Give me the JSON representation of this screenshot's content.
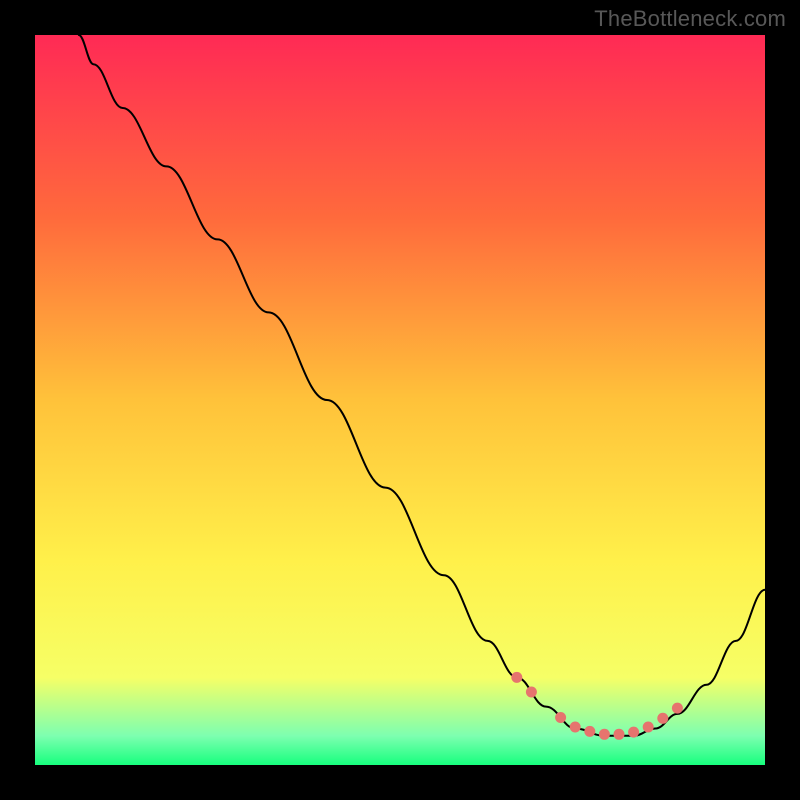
{
  "watermark": "TheBottleneck.com",
  "colors": {
    "frame_bg": "#000000",
    "curve": "#000000",
    "marker": "#e6746e",
    "gradient_stops": [
      {
        "offset": "0%",
        "color": "#ff2a55"
      },
      {
        "offset": "25%",
        "color": "#ff6a3c"
      },
      {
        "offset": "50%",
        "color": "#ffc23a"
      },
      {
        "offset": "72%",
        "color": "#fff04a"
      },
      {
        "offset": "88%",
        "color": "#f6ff66"
      },
      {
        "offset": "96%",
        "color": "#7dffb0"
      },
      {
        "offset": "100%",
        "color": "#17ff7e"
      }
    ]
  },
  "chart_data": {
    "type": "line",
    "title": "",
    "xlabel": "",
    "ylabel": "",
    "xlim": [
      0,
      100
    ],
    "ylim": [
      0,
      100
    ],
    "series": [
      {
        "name": "bottleneck_curve",
        "x": [
          6,
          8,
          12,
          18,
          25,
          32,
          40,
          48,
          56,
          62,
          66,
          70,
          74,
          78,
          82,
          85,
          88,
          92,
          96,
          100
        ],
        "y": [
          100,
          96,
          90,
          82,
          72,
          62,
          50,
          38,
          26,
          17,
          12,
          8,
          5,
          4,
          4,
          5,
          7,
          11,
          17,
          24
        ]
      }
    ],
    "markers": {
      "name": "highlight_points",
      "x": [
        66,
        68,
        72,
        74,
        76,
        78,
        80,
        82,
        84,
        86,
        88
      ],
      "y": [
        12,
        10,
        6.5,
        5.2,
        4.6,
        4.2,
        4.2,
        4.5,
        5.2,
        6.4,
        7.8
      ]
    }
  }
}
